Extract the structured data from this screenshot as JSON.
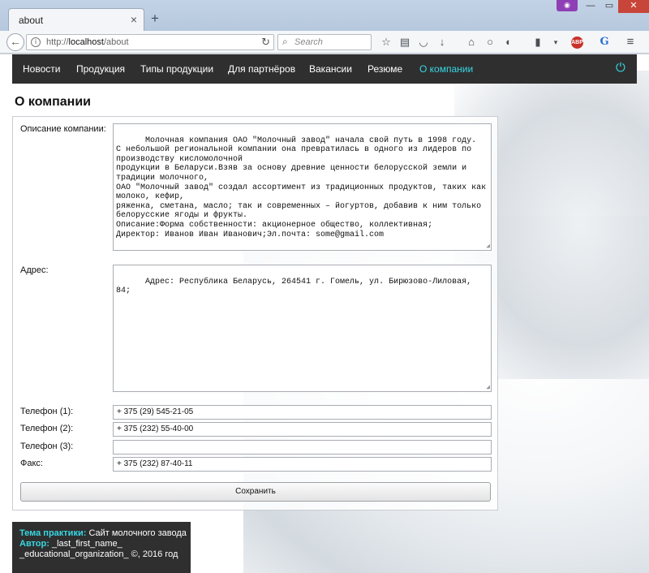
{
  "browser": {
    "tab_title": "about",
    "tab_close": "×",
    "new_tab": "+",
    "url_prefix": "http://",
    "url_host": "localhost",
    "url_path": "/about",
    "search_placeholder": "Search",
    "ext_badge": "👓",
    "abp_label": "ABP"
  },
  "site_nav": {
    "items": [
      "Новости",
      "Продукция",
      "Типы продукции",
      "Для партнёров",
      "Вакансии",
      "Резюме",
      "О компании"
    ],
    "active": "О компании",
    "accent_color": "#38d7e3"
  },
  "page": {
    "title": "О компании"
  },
  "form": {
    "description_label": "Описание компании:",
    "description_value": "Молочная компания ОАО \"Молочный завод\" начала свой путь в 1998 году.\nС небольшой региональной компании она превратилась в одного из лидеров по производству кисломолочной\nпродукции в Беларуси.Взяв за основу древние ценности белорусской земли и традиции молочного,\nОАО \"Молочный завод\" создал ассортимент из традиционных продуктов, таких как молоко, кефир,\nряженка, сметана, масло; так и современных – йогуртов, добавив к ним только белорусские ягоды и фрукты.\nОписание:Форма собственности: акционерное общество, коллективная;\nДиректор: Иванов Иван Иванович;Эл.почта: some@gmail.com",
    "address_label": "Адрес:",
    "address_value": "Адрес: Республика Беларусь, 264541 г. Гомель, ул. Бирюзово-Лиловая, 84;",
    "phone1_label": "Телефон (1):",
    "phone1_value": "+ 375 (29) 545-21-05",
    "phone2_label": "Телефон (2):",
    "phone2_value": "+ 375 (232) 55-40-00",
    "phone3_label": "Телефон (3):",
    "phone3_value": "",
    "fax_label": "Факс:",
    "fax_value": "+ 375 (232) 87-40-11",
    "save_label": "Сохранить"
  },
  "footer": {
    "topic_label": "Тема практики:",
    "topic_value": " Сайт молочного завода",
    "author_label": "Автор:",
    "author_value": " _last_first_name_",
    "org_line": "_educational_organization_ ©, 2016 год"
  }
}
